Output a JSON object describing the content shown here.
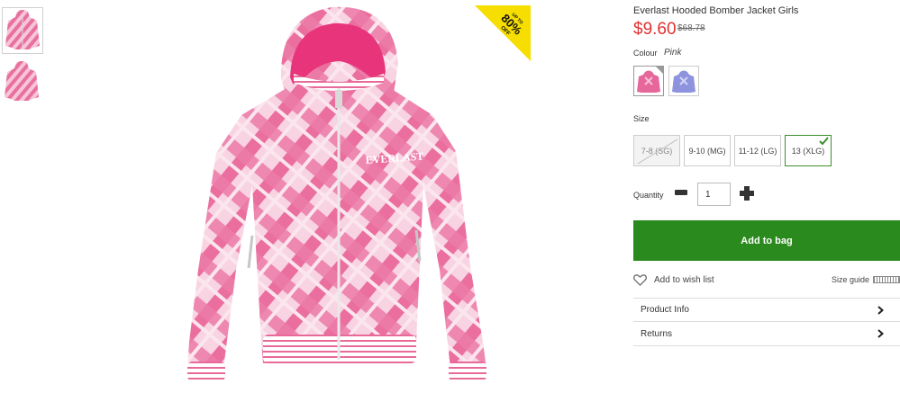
{
  "product": {
    "title": "Everlast Hooded Bomber Jacket Girls",
    "price": "$9.60",
    "was_price": "$68.78",
    "badge": {
      "top": "UP TO",
      "pct": "80%",
      "bottom": "OFF",
      "color": "#f5de00"
    },
    "jacket_brand": "EVERLAST"
  },
  "thumbs": [
    {
      "name": "thumb-front",
      "selected": true
    },
    {
      "name": "thumb-back",
      "selected": false
    }
  ],
  "colour": {
    "label": "Colour",
    "value": "Pink",
    "swatches": [
      {
        "name": "Pink",
        "selected": true,
        "color": "#e5679b"
      },
      {
        "name": "Purple",
        "selected": false,
        "color": "#8e93dd"
      }
    ]
  },
  "size": {
    "label": "Size",
    "options": [
      {
        "label": "7-8 (SG)",
        "available": false
      },
      {
        "label": "9-10 (MG)",
        "available": true
      },
      {
        "label": "11-12 (LG)",
        "available": true
      },
      {
        "label": "13 (XLG)",
        "available": true,
        "selected": true
      }
    ]
  },
  "quantity": {
    "label": "Quantity",
    "value": "1"
  },
  "add_to_bag": "Add to bag",
  "wishlist": "Add to wish list",
  "size_guide": "Size guide",
  "accordion": [
    {
      "label": "Product Info"
    },
    {
      "label": "Returns"
    }
  ],
  "colors": {
    "accent_green": "#2b8a1d",
    "price_red": "#e23131"
  }
}
